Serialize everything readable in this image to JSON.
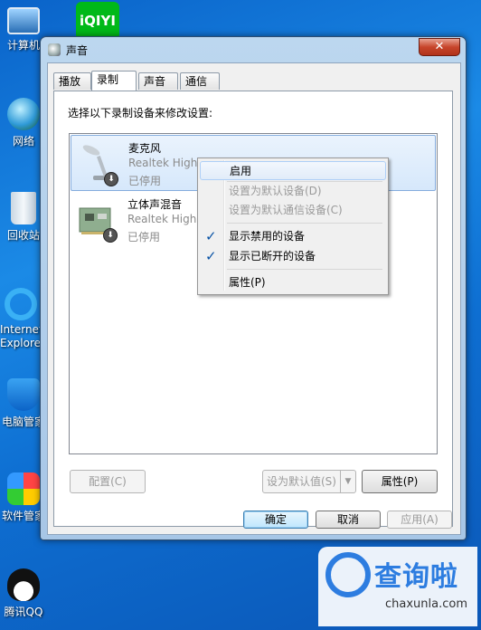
{
  "desktop": {
    "icons": [
      {
        "label": "计算机"
      },
      {
        "label": "网络"
      },
      {
        "label": "回收站"
      },
      {
        "label": "Internet\nExplorer"
      },
      {
        "label": "电脑管家"
      },
      {
        "label": "软件管家"
      },
      {
        "label": "腾讯QQ"
      }
    ],
    "iqiyi_logo": "iQIYI"
  },
  "window": {
    "title": "声音",
    "close_glyph": "✕",
    "tabs": [
      {
        "label": "播放"
      },
      {
        "label": "录制",
        "active": true
      },
      {
        "label": "声音"
      },
      {
        "label": "通信"
      }
    ],
    "prompt": "选择以下录制设备来修改设置:",
    "devices": [
      {
        "name": "麦克风",
        "driver": "Realtek High Definition Audio",
        "status": "已停用",
        "selected": true
      },
      {
        "name": "立体声混音",
        "driver": "Realtek High Definition Audio",
        "status": "已停用",
        "selected": false
      }
    ],
    "buttons": {
      "configure": "配置(C)",
      "set_default": "设为默认值(S)",
      "properties": "属性(P)",
      "ok": "确定",
      "cancel": "取消",
      "apply": "应用(A)"
    }
  },
  "context_menu": {
    "items": [
      {
        "label": "启用",
        "enabled": true,
        "checked": false
      },
      {
        "label": "设置为默认设备(D)",
        "enabled": false,
        "checked": false
      },
      {
        "label": "设置为默认通信设备(C)",
        "enabled": false,
        "checked": false
      },
      {
        "label": "显示禁用的设备",
        "enabled": true,
        "checked": true
      },
      {
        "label": "显示已断开的设备",
        "enabled": true,
        "checked": true
      },
      {
        "label": "属性(P)",
        "enabled": true,
        "checked": false
      }
    ],
    "check_glyph": "✓"
  },
  "watermark": {
    "brand": "查询啦",
    "url": "chaxunla.com"
  },
  "colors": {
    "desktop_blue": "#1b8ae6",
    "selection": "#d6e8fb",
    "check": "#0b54a6"
  }
}
